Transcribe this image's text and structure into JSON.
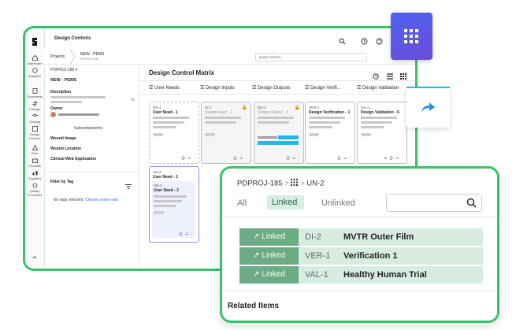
{
  "app": {
    "title": "Design Controls",
    "breadcrumb": {
      "root": "Projects",
      "current": "NEW - PEMS",
      "sub": "(PDPROJ-185)"
    },
    "search_placeholder": "Quick Search..."
  },
  "rail": [
    {
      "label": "Dashboard",
      "icon": "home-icon"
    },
    {
      "label": "Analytics",
      "icon": "analytics-icon"
    },
    {
      "label": "Documents",
      "icon": "documents-icon"
    },
    {
      "label": "Change",
      "icon": "change-icon"
    },
    {
      "label": "Training",
      "icon": "training-icon"
    },
    {
      "label": "Design Controls",
      "icon": "design-controls-icon"
    },
    {
      "label": "Risk",
      "icon": "risk-icon"
    },
    {
      "label": "Products",
      "icon": "products-icon"
    },
    {
      "label": "Suppliers",
      "icon": "suppliers-icon"
    },
    {
      "label": "Quality Processes",
      "icon": "quality-icon"
    }
  ],
  "project": {
    "id_label": "PDPROJ-185",
    "name": "NEW - PEMS",
    "description_label": "Discription",
    "owner_label": "Owner",
    "subcomponents_label": "Subcomponents",
    "subcomponents": [
      "Wound Image",
      "Wound Location",
      "Clinical Web Application"
    ],
    "filter_label": "Filter by Tag",
    "no_tags": "No tags selected.",
    "choose_link": "Choose some now."
  },
  "matrix": {
    "title": "Design Control Matrix",
    "columns": [
      "User Needs",
      "Design Inputs",
      "Design Outputs",
      "Design Verifi...",
      "Design Validation"
    ],
    "cards": [
      {
        "id": "UN-1",
        "title": "User Need - 1",
        "style": "dash"
      },
      {
        "id": "DI-2",
        "title": "Design Input - 2",
        "style": "dim"
      },
      {
        "id": "DO-2",
        "title": "Design Output - 1",
        "style": "dim"
      },
      {
        "id": "VER-1",
        "title": "Design Verification - 1",
        "style": "solid"
      },
      {
        "id": "VAL-1",
        "title": "Design Validation - 6",
        "style": "solid"
      }
    ],
    "card2": {
      "id": "UN-2",
      "title": "User Need - 2"
    },
    "card2_inner": {
      "id": "UN-2",
      "title": "User Need - 2"
    }
  },
  "overlay": {
    "project_id": "PDPROJ-185",
    "sep": ">",
    "item": "UN-2",
    "tabs": [
      "All",
      "Linked",
      "Unlinked"
    ],
    "active_tab": "Linked",
    "rows": [
      {
        "action": "Linked",
        "id": "DI-2",
        "name": "MVTR Outer Film"
      },
      {
        "action": "Linked",
        "id": "VER-1",
        "name": "Verification 1"
      },
      {
        "action": "Linked",
        "id": "VAL-1",
        "name": "Healthy Human Trial"
      }
    ],
    "related": "Related Items"
  },
  "colors": {
    "accent_green": "#34c46a",
    "linked_green": "#6dab86",
    "row_bg": "#d9ece1",
    "tile_blue": "#4a63f0",
    "link_blue": "#2b6fd6"
  }
}
